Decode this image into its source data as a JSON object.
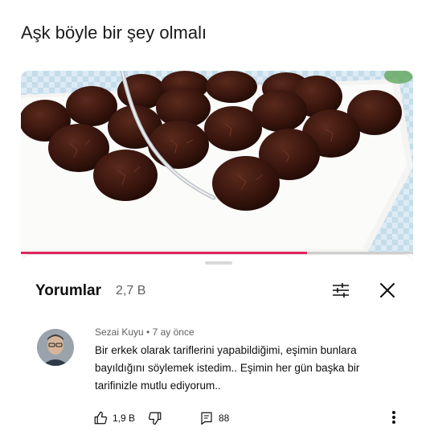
{
  "post": {
    "caption": "Aşk böyle bir şey olmalı"
  },
  "video": {
    "progress_fraction": 0.73,
    "progress_color": "#e0245e"
  },
  "comments_panel": {
    "title": "Yorumlar",
    "count": "2,7 B",
    "filter_icon": "sliders-icon",
    "close_icon": "close-icon"
  },
  "comment": {
    "author": "Sezai Kuyu",
    "separator": "•",
    "time": "7 ay önce",
    "text": "Bir erkek olarak tariflerini yapabildiğimi, eşimin bunlara bayıldığını söylemek istedim.. Eşimin her gün başka bir tarifinizle mutlu ediyorum..",
    "like_count": "1,9 B",
    "reply_count": "88",
    "icons": {
      "like": "thumb-up-icon",
      "dislike": "thumb-down-icon",
      "reply": "reply-icon",
      "more": "more-vertical-icon"
    }
  }
}
